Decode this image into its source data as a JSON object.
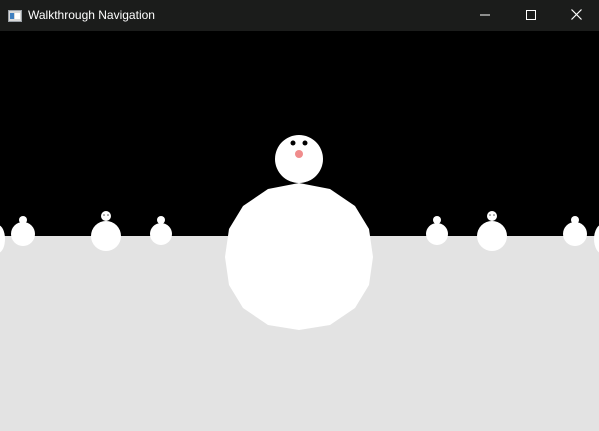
{
  "window": {
    "title": "Walkthrough Navigation"
  },
  "controls": {
    "minimize_icon": "minimize-icon",
    "maximize_icon": "maximize-icon",
    "close_icon": "close-icon"
  },
  "scene": {
    "sky_color": "#000000",
    "ground_color": "#e3e3e3",
    "snow_color": "#ffffff",
    "nose_color": "#f08c8c",
    "eye_color": "#000000"
  }
}
